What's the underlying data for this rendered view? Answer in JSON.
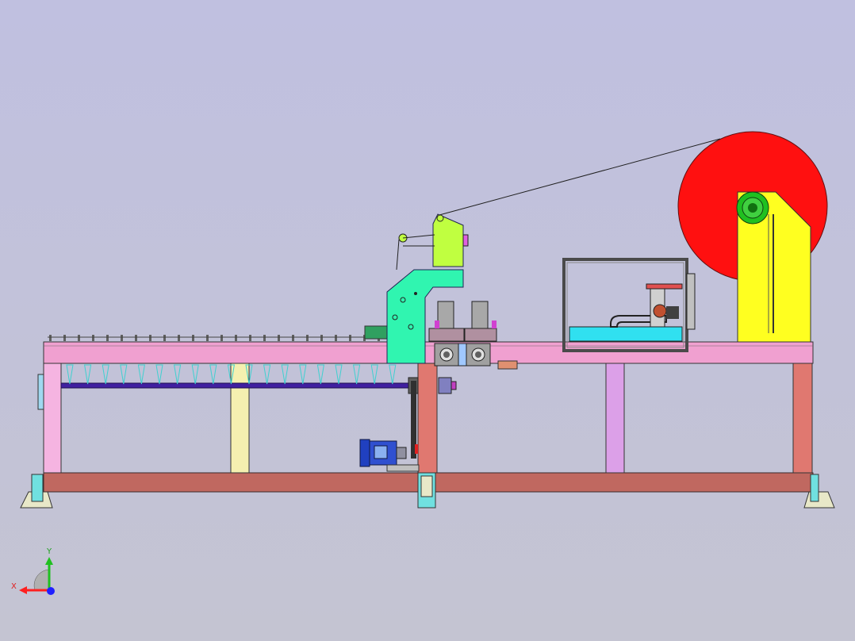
{
  "viewport": {
    "background_top": "#c0c0e0",
    "background_bottom": "#c4c4d2"
  },
  "triad": {
    "x_label": "X",
    "y_label": "Y",
    "x_color": "#ff2020",
    "y_color": "#20c020",
    "z_color": "#2020ff"
  },
  "colors": {
    "frame_rail": "#f0a0d0",
    "frame_leg": "#f5b4e1",
    "base_beam": "#c06860",
    "red_leg": "#e07870",
    "cream_post": "#f5f0b0",
    "violet_post": "#dca0e8",
    "spool": "#ff1010",
    "spool_stand": "#ffff20",
    "spool_hub": "#20c020",
    "head_green": "#30f5b0",
    "arm_green": "#c0ff40",
    "shaft": "#4020a0",
    "nozzle": "#40d0d0",
    "motor_blue": "#2040c0",
    "cabinet_frame": "#4a4a4a",
    "cyan_part": "#30e0f0",
    "wire": "#202020"
  }
}
